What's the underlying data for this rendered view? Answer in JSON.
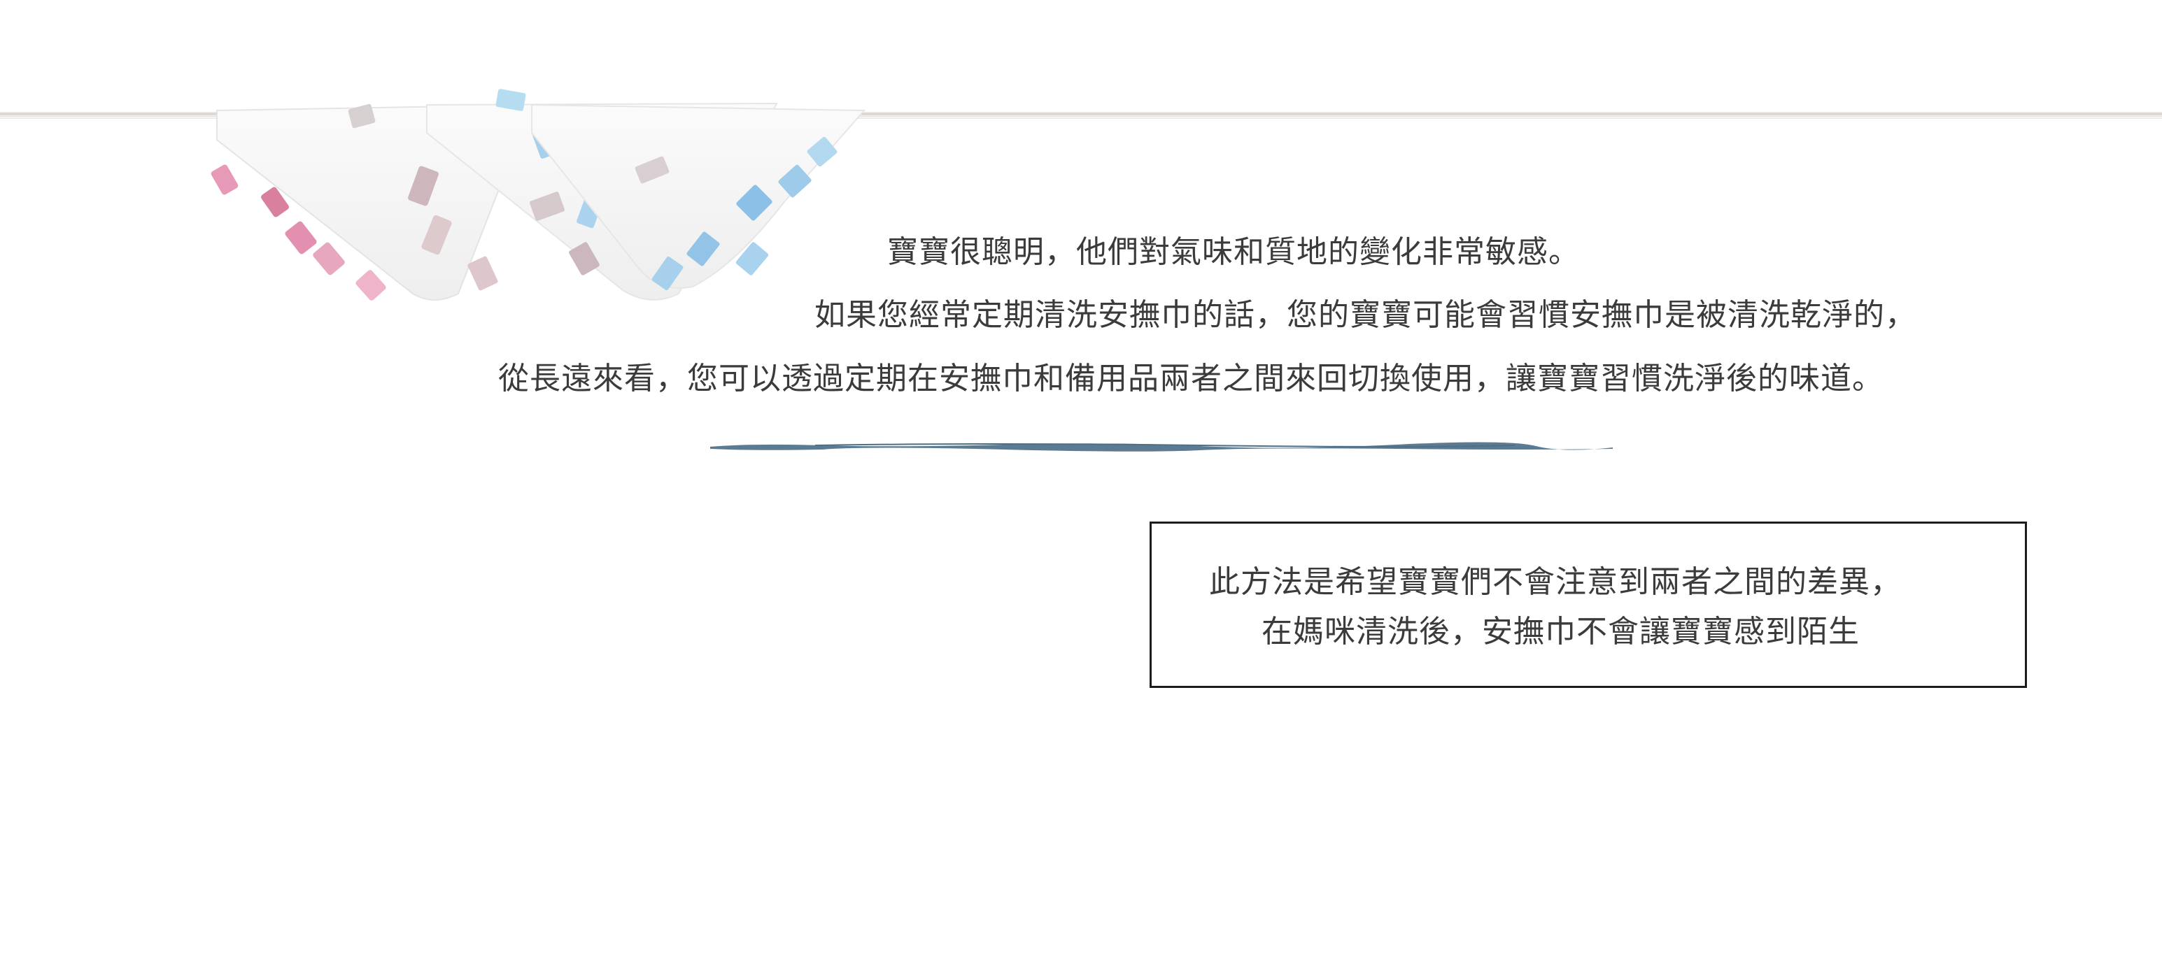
{
  "intro_paragraph": {
    "lines": [
      "寶寶很聰明，他們對氣味和質地的變化非常敏感。",
      "如果您經常定期清洗安撫巾的話，您的寶寶可能會習慣安撫巾是被清洗乾淨的，",
      "從長遠來看，您可以透過定期在安撫巾和備用品兩者之間來回切換使用，讓寶寶習慣洗淨後的味道。"
    ]
  },
  "note_box": {
    "lines": [
      "此方法是希望寶寶們不會注意到兩者之間的差異，",
      "在媽咪清洗後，安撫巾不會讓寶寶感到陌生"
    ]
  },
  "colors": {
    "text": "#3b3b3b",
    "divider": "#5b7b92",
    "box_border": "#1c1c1c",
    "rope": "#e4e0dc",
    "pink_tag": "#e59ab8",
    "blue_tag": "#9fcbea",
    "mauve_tag": "#c8b4b8"
  },
  "illustration": {
    "subject": "baby comfort blankets with ribbon tags hanging on a clothesline"
  }
}
